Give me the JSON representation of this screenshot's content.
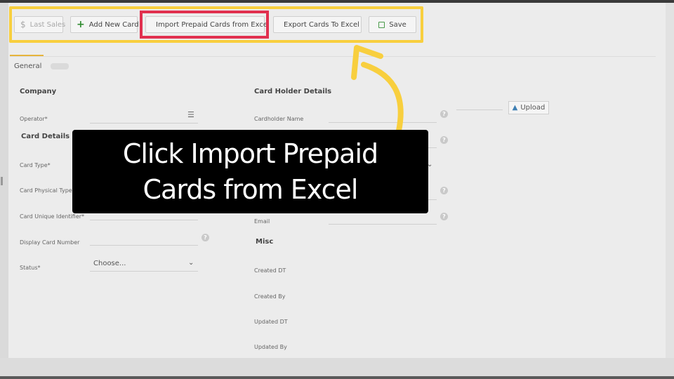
{
  "toolbar": {
    "last_sales_label": "Last Sales",
    "add_new_card_label": "Add New Card",
    "import_label": "Import Prepaid Cards from Excel",
    "export_label": "Export Cards To Excel",
    "save_label": "Save"
  },
  "tabs": {
    "general": "General"
  },
  "left": {
    "company_title": "Company",
    "operator_label": "Operator*",
    "card_details_title": "Card Details",
    "card_type_label": "Card Type*",
    "card_physical_type_label": "Card Physical Type*",
    "card_unique_identifier_label": "Card Unique Identifier*",
    "display_card_number_label": "Display Card Number",
    "status_label": "Status*",
    "status_value": "Choose..."
  },
  "right": {
    "holder_title": "Card Holder Details",
    "cardholder_name_label": "Cardholder Name",
    "email_label": "Email",
    "upload_label": "Upload",
    "misc_title": "Misc",
    "created_dt_label": "Created DT",
    "created_by_label": "Created By",
    "updated_dt_label": "Updated DT",
    "updated_by_label": "Updated By"
  },
  "overlay": {
    "line1": "Click Import Prepaid",
    "line2": "Cards from Excel"
  },
  "colors": {
    "highlight_yellow": "#f8cf3e",
    "highlight_red": "#e1304f",
    "overlay_bg": "#000000"
  },
  "icons": {
    "last_sales": "dollar-icon",
    "add": "plus-icon",
    "import": "excel-icon",
    "export": "excel-icon",
    "save": "save-icon",
    "upload": "upload-icon",
    "help": "help-icon",
    "list": "list-icon",
    "chevron": "chevron-down-icon"
  }
}
